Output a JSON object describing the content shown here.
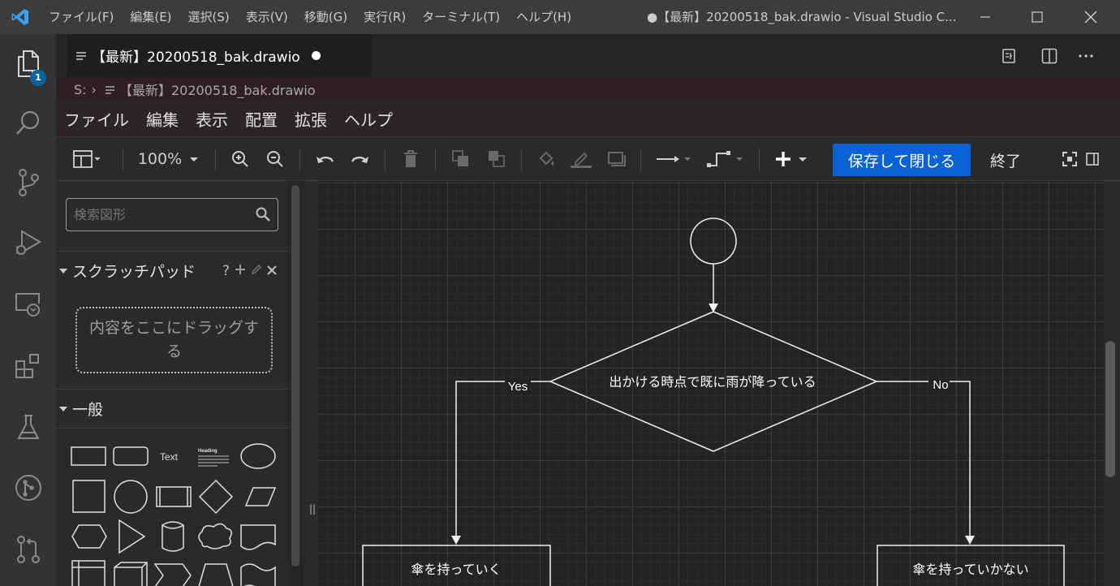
{
  "window": {
    "menu": [
      "ファイル(F)",
      "編集(E)",
      "選択(S)",
      "表示(V)",
      "移動(G)",
      "実行(R)",
      "ターミナル(T)",
      "ヘルプ(H)"
    ],
    "title": "●【最新】20200518_bak.drawio - Visual Studio C..."
  },
  "activity": {
    "explorer_badge": "1"
  },
  "tab": {
    "label": "【最新】20200518_bak.drawio"
  },
  "breadcrumb": {
    "drive": "S:",
    "file": "【最新】20200518_bak.drawio"
  },
  "drawio_menu": [
    "ファイル",
    "編集",
    "表示",
    "配置",
    "拡張",
    "ヘルプ"
  ],
  "toolbar": {
    "zoom": "100%",
    "save_close": "保存して閉じる",
    "exit": "終了"
  },
  "sidebar": {
    "search_placeholder": "検索図形",
    "scratchpad_title": "スクラッチパッド",
    "scratchpad_help": "?",
    "dropzone_text": "内容をここにドラッグする",
    "general_title": "一般",
    "text_shape_label": "Text",
    "heading_shape_label": "Heading"
  },
  "diagram": {
    "decision": "出かける時点で既に雨が降っている",
    "yes_label": "Yes",
    "no_label": "No",
    "left_box": "傘を持っていく",
    "right_box": "傘を持っていかない"
  },
  "colors": {
    "accent": "#0b62d6",
    "badge": "#0e639c",
    "titlebar": "#3c3c3c",
    "activity": "#333333"
  }
}
